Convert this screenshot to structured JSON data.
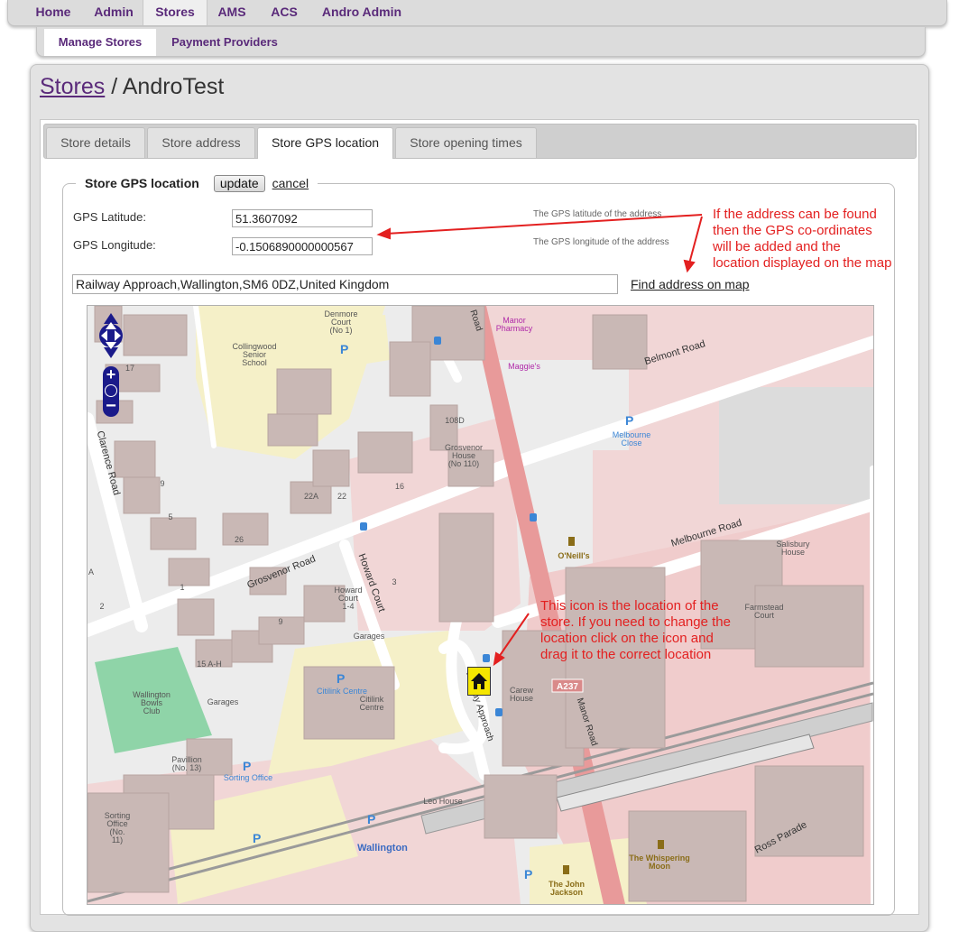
{
  "top_nav": [
    "Home",
    "Admin",
    "Stores",
    "AMS",
    "ACS",
    "Andro Admin"
  ],
  "sub_nav": [
    "Manage Stores",
    "Payment Providers"
  ],
  "breadcrumb": {
    "link": "Stores",
    "separator": " / ",
    "current": "AndroTest"
  },
  "tabs": [
    "Store details",
    "Store address",
    "Store GPS location",
    "Store opening times"
  ],
  "form": {
    "legend": "Store GPS location",
    "update_label": "update",
    "cancel_label": "cancel",
    "latitude_label": "GPS Latitude:",
    "latitude_value": "51.3607092",
    "latitude_hint": "The GPS latitude of the address",
    "longitude_label": "GPS Longitude:",
    "longitude_value": "-0.1506890000000567",
    "longitude_hint": "The GPS longitude of the address",
    "address_value": "Railway Approach,Wallington,SM6 0DZ,United Kingdom",
    "find_link": "Find address on map"
  },
  "annotations": {
    "address_note": [
      "If the address can be found",
      "then the GPS co-ordinates",
      "will be added and the",
      "location displayed on the map"
    ],
    "icon_note": [
      "This icon is the location of the",
      "store.  If you need to change the",
      "location click on the icon and",
      "drag it to the correct location"
    ]
  },
  "map_labels": {
    "clarence_road": "Clarence Road",
    "collingwood": [
      "Collingwood",
      "Senior",
      "School"
    ],
    "denmore": [
      "Denmore",
      "Court",
      "(No 1)"
    ],
    "manor_pharmacy": [
      "Manor",
      "Pharmacy"
    ],
    "maggies": "Maggie's",
    "belmont_road": "Belmont Road",
    "melbourne_close": [
      "Melbourne",
      "Close"
    ],
    "melbourne_road": "Melbourne Road",
    "oneills": "O'Neill's",
    "salisbury": [
      "Salisbury",
      "House"
    ],
    "farmstead": [
      "Farmstead",
      "Court"
    ],
    "grosvenor_house": [
      "Grosvenor",
      "House",
      "(No 110)"
    ],
    "grosvenor_road": "Grosvenor Road",
    "howard_court_road": "Howard Court",
    "howard_court": [
      "Howard",
      "Court",
      "1-4"
    ],
    "garages": "Garages",
    "wallington_bowls": [
      "Wallington",
      "Bowls",
      "Club"
    ],
    "citilink_centre_blue": "Citilink Centre",
    "citilink_centre": [
      "Citilink",
      "Centre"
    ],
    "pavillion": [
      "Pavillion",
      "(No. 13)"
    ],
    "sorting_office_blue": "Sorting Office",
    "sorting_office": [
      "Sorting",
      "Office",
      "(No.",
      "11)"
    ],
    "wallington": "Wallington",
    "leo_house": "Leo House",
    "carew_house": [
      "Carew",
      "House"
    ],
    "a237": "A237",
    "manor_road": "Manor Road",
    "road_top": "Road",
    "railway_approach": "Railway Approach",
    "whispering_moon": [
      "The Whispering",
      "Moon"
    ],
    "john_jackson": [
      "The John",
      "Jackson"
    ],
    "ross_parade": "Ross Parade",
    "house_numbers": [
      "17",
      "9",
      "5",
      "26",
      "22A",
      "22",
      "16",
      "108D",
      "1",
      "2",
      "A",
      "3",
      "9",
      "15 A-H"
    ]
  },
  "colors": {
    "nav_text": "#5a2a7a",
    "annotation": "#e32020",
    "major_road": "#e89a9a",
    "residential": "#f5f0c8",
    "buildings": "#c9b8b5"
  }
}
